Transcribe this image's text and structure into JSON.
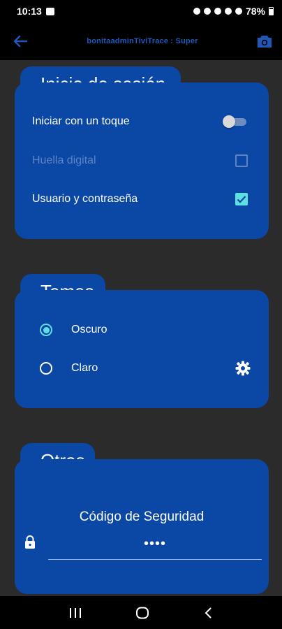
{
  "status_bar": {
    "time": "10:13",
    "battery": "78%"
  },
  "app_bar": {
    "title": "bonitaadminTiviTrace : Super"
  },
  "login": {
    "title": "Inicio de sesión",
    "items": [
      {
        "label": "Iniciar con un toque",
        "control": "switch",
        "state": "off"
      },
      {
        "label": "Huella digital",
        "control": "checkbox",
        "state": "disabled"
      },
      {
        "label": "Usuario y contraseña",
        "control": "checkbox",
        "state": "checked"
      }
    ]
  },
  "themes": {
    "title": "Temas",
    "options": [
      {
        "label": "Oscuro",
        "selected": true,
        "icon": "moon-icon"
      },
      {
        "label": "Claro",
        "selected": false,
        "icon": "gear-icon"
      }
    ]
  },
  "others": {
    "title": "Otros",
    "security_label": "Código de Seguridad",
    "security_value": "••••",
    "icon": "lock-icon"
  },
  "colors": {
    "background": "#2b2b2b",
    "card": "#0b47a5",
    "accent": "#5fe0e0",
    "bar": "#000000",
    "title_text": "#1e58b8"
  }
}
